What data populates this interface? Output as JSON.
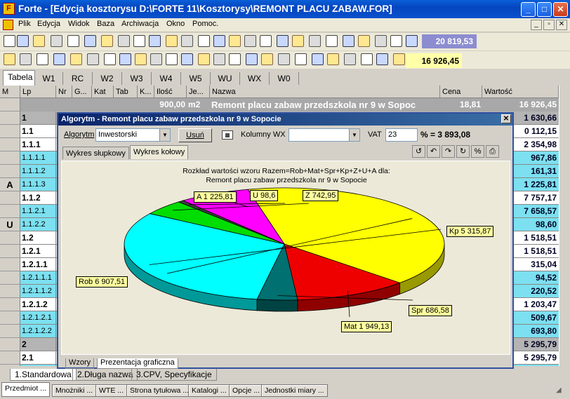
{
  "window": {
    "title": "Forte - [Edycja kosztorysu D:\\FORTE 11\\Kosztorysy\\REMONT PLACU ZABAW.FOR]",
    "icon": "F",
    "min": "_",
    "max": "□",
    "close": "✕"
  },
  "menu": [
    "Plik",
    "Edycja",
    "Widok",
    "Baza",
    "Archiwacja",
    "Okno",
    "Pomoc."
  ],
  "toolbar": {
    "total1": "20 819,53",
    "total2": "16 926,45"
  },
  "tabs_top": [
    "Tabela",
    "W1",
    "RC",
    "W2",
    "W3",
    "W4",
    "W5",
    "WU",
    "WX",
    "W0"
  ],
  "columns": [
    "M",
    "Lp",
    "Nr",
    "G...",
    "Kat",
    "Tab",
    "K...",
    "Ilość",
    "Je...",
    "Nazwa",
    "Cena",
    "Wartość"
  ],
  "summary_row": {
    "ilosc": "900,00",
    "jm": "m2",
    "nazwa": "Remont placu zabaw przedszkola nr 9 w Sopoc",
    "cena": "18,81",
    "wartosc": "16 926,45"
  },
  "rows": [
    {
      "m": "",
      "lp": "1",
      "val": "1 630,66",
      "kind": "g"
    },
    {
      "m": "",
      "lp": "1.1",
      "val": "0 112,15",
      "kind": "w"
    },
    {
      "m": "",
      "lp": "1.1.1",
      "val": "2 354,98",
      "kind": "w"
    },
    {
      "m": "",
      "lp": "1.1.1.1",
      "val": "967,86",
      "kind": "c"
    },
    {
      "m": "",
      "lp": "1.1.1.2",
      "val": "161,31",
      "kind": "c"
    },
    {
      "m": "A",
      "lp": "1.1.1.3",
      "val": "1 225,81",
      "kind": "c"
    },
    {
      "m": "",
      "lp": "1.1.2",
      "val": "7 757,17",
      "kind": "w"
    },
    {
      "m": "",
      "lp": "1.1.2.1",
      "val": "7 658,57",
      "kind": "c"
    },
    {
      "m": "U",
      "lp": "1.1.2.2",
      "val": "98,60",
      "kind": "c"
    },
    {
      "m": "",
      "lp": "1.2",
      "val": "1 518,51",
      "kind": "w"
    },
    {
      "m": "",
      "lp": "1.2.1",
      "val": "1 518,51",
      "kind": "w"
    },
    {
      "m": "",
      "lp": "1.2.1.1",
      "val": "315,04",
      "kind": "w"
    },
    {
      "m": "",
      "lp": "1.2.1.1.1",
      "val": "94,52",
      "kind": "c"
    },
    {
      "m": "",
      "lp": "1.2.1.1.2",
      "val": "220,52",
      "kind": "c"
    },
    {
      "m": "",
      "lp": "1.2.1.2",
      "val": "1 203,47",
      "kind": "w"
    },
    {
      "m": "",
      "lp": "1.2.1.2.1",
      "val": "509,67",
      "kind": "c"
    },
    {
      "m": "",
      "lp": "1.2.1.2.2",
      "val": "693,80",
      "kind": "c"
    },
    {
      "m": "",
      "lp": "2",
      "val": "5 295,79",
      "kind": "g"
    },
    {
      "m": "",
      "lp": "2.1",
      "val": "5 295,79",
      "kind": "w"
    },
    {
      "m": "",
      "lp": "2.1.1",
      "val": "5 295,79",
      "kind": "c"
    }
  ],
  "tabs_bottom": [
    "1.Standardowa",
    "2.Długa nazwa",
    "3.CPV, Specyfikacje"
  ],
  "status": [
    "Przedmiot ...",
    "Mnożniki ...",
    "WTE ...",
    "Strona tytułowa ...",
    "Katalogi ...",
    "Opcje ...",
    "Jednostki miary ..."
  ],
  "dialog": {
    "title": "Algorytm - Remont placu zabaw przedszkola nr 9 w Sopocie",
    "close": "✕",
    "algorytm_label": "Algorytm",
    "algorytm_value": "Inwestorski",
    "usun": "Usuń",
    "kolumny_label": "Kolumny WX",
    "kolumny_value": "",
    "vat_label": "VAT",
    "vat_value": "23",
    "vat_result": "% = 3 893,08",
    "tab1": "Wykres słupkowy",
    "tab2": "Wykres kołowy",
    "bottom_tab1": "Wzory",
    "bottom_tab2": "Prezentacja graficzna"
  },
  "chart_data": {
    "type": "pie",
    "title": "Rozkład wartości wzoru  Razem=Rob+Mat+Spr+Kp+Z+U+A  dla:",
    "subtitle": "Remont placu zabaw przedszkola nr 9 w Sopocie",
    "slices": [
      {
        "label": "Rob 6 907,51",
        "name": "Rob",
        "value": 6907.51,
        "color": "#ffff00"
      },
      {
        "label": "Mat 1 949,13",
        "name": "Mat",
        "value": 1949.13,
        "color": "#ee0000"
      },
      {
        "label": "Spr 686,58",
        "name": "Spr",
        "value": 686.58,
        "color": "#007070"
      },
      {
        "label": "Kp 5 315,87",
        "name": "Kp",
        "value": 5315.87,
        "color": "#00ffff"
      },
      {
        "label": "Z 742,95",
        "name": "Z",
        "value": 742.95,
        "color": "#00dd00"
      },
      {
        "label": "U 98,6",
        "name": "U",
        "value": 98.6,
        "color": "#404040"
      },
      {
        "label": "A 1 225,81",
        "name": "A",
        "value": 1225.81,
        "color": "#ff00ff"
      }
    ]
  }
}
